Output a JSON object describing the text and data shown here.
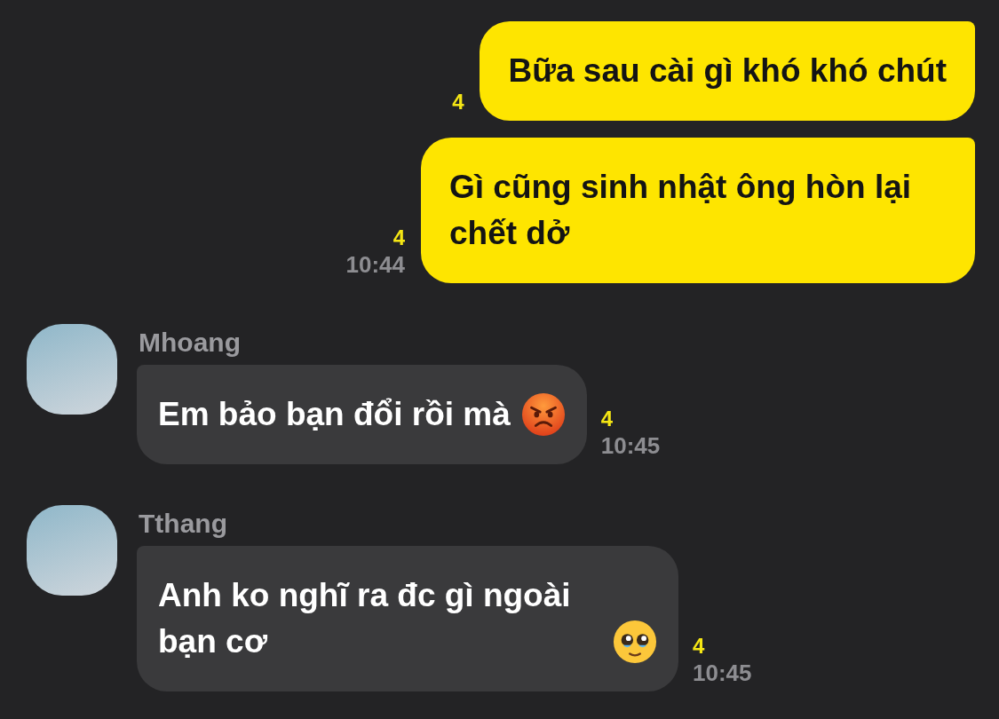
{
  "messages": [
    {
      "kind": "outgoing",
      "text": "Bữa sau cài gì khó khó chút",
      "unread": "4"
    },
    {
      "kind": "outgoing",
      "text": "Gì cũng sinh nhật ông hòn lại chết dở",
      "unread": "4",
      "time": "10:44"
    },
    {
      "kind": "incoming",
      "sender": "Mhoang",
      "text": "Em bảo bạn đổi rồi mà",
      "emoji": {
        "kind": "angry"
      },
      "unread": "4",
      "time": "10:45"
    },
    {
      "kind": "incoming",
      "sender": "Tthang",
      "text": "Anh ko nghĩ ra đc gì ngoài bạn cơ",
      "emoji": {
        "kind": "pleading"
      },
      "unread": "4",
      "time": "10:45"
    }
  ]
}
